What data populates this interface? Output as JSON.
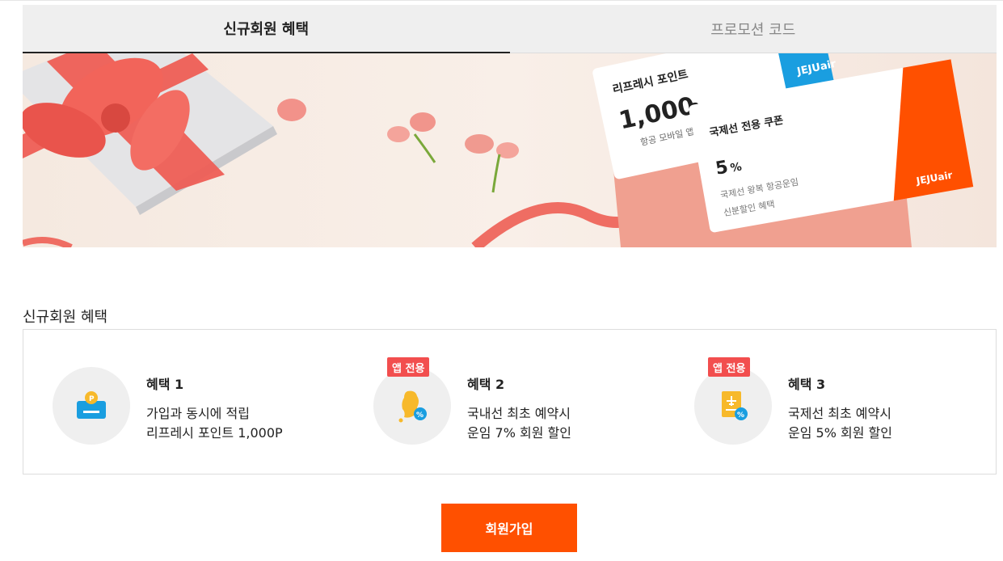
{
  "tabs": [
    {
      "label": "신규회원 혜택",
      "active": true
    },
    {
      "label": "프로모션 코드",
      "active": false
    }
  ],
  "banner": {
    "card1": {
      "title": "리프레시 포인트",
      "amount": "1,000",
      "unit": "P",
      "desc": "항공 모바일 앱 사용 전용",
      "brand": "JEJUair"
    },
    "card2": {
      "title": "국제선 전용 쿠폰",
      "percent": "5",
      "percent_sign": "%",
      "desc1": "국제선 왕복 항공운임",
      "desc2": "신분할인 혜택",
      "brand": "JEJUair"
    }
  },
  "section_title": "신규회원 혜택",
  "benefits": [
    {
      "title": "혜택 1",
      "line1": "가입과 동시에 적립",
      "line2": "리프레시 포인트 1,000P",
      "badge": "",
      "icon": "wallet-coin-icon"
    },
    {
      "title": "혜택 2",
      "line1": "국내선 최초 예약시",
      "line2": "운임 7% 회원 할인",
      "badge": "앱 전용",
      "icon": "korea-map-discount-icon"
    },
    {
      "title": "혜택 3",
      "line1": "국제선 최초 예약시",
      "line2": "운임 5% 회원 할인",
      "badge": "앱 전용",
      "icon": "passport-discount-icon"
    }
  ],
  "join_button": "회원가입",
  "colors": {
    "accent": "#ff5000",
    "badge": "#f24e4e",
    "icon_yellow": "#f7b92b",
    "icon_blue": "#1a9ee0"
  }
}
